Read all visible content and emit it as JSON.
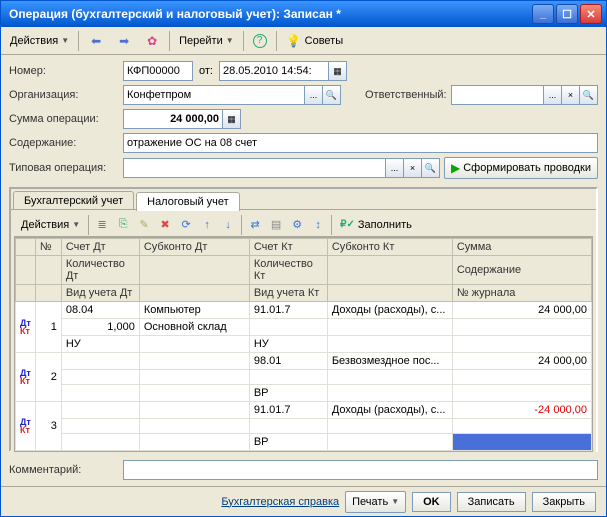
{
  "window": {
    "title": "Операция (бухгалтерский и налоговый учет): Записан *"
  },
  "main_toolbar": {
    "actions": "Действия",
    "go_to": "Перейти",
    "tips": "Советы"
  },
  "form": {
    "number_label": "Номер:",
    "number_value": "КФП00000",
    "from_label": "от:",
    "date_value": "28.05.2010 14:54:",
    "org_label": "Организация:",
    "org_value": "Конфетпром",
    "resp_label": "Ответственный:",
    "resp_value": "",
    "sum_label": "Сумма операции:",
    "sum_value": "24 000,00",
    "content_label": "Содержание:",
    "content_value": "отражение ОС на 08 счет",
    "typeop_label": "Типовая операция:",
    "typeop_value": "",
    "gen_entries": "Сформировать проводки",
    "comment_label": "Комментарий:",
    "comment_value": ""
  },
  "tabs": {
    "t1": "Бухгалтерский учет",
    "t2": "Налоговый учет"
  },
  "grid_toolbar": {
    "actions": "Действия",
    "fill": "Заполнить"
  },
  "grid": {
    "headers": {
      "num": "№",
      "acc_dt": "Счет Дт",
      "sub_dt": "Субконто Дт",
      "acc_kt": "Счет Кт",
      "sub_kt": "Субконто Кт",
      "sum": "Сумма",
      "qty_dt": "Количество Дт",
      "qty_kt": "Количество Кт",
      "content": "Содержание",
      "vid_dt": "Вид учета Дт",
      "vid_kt": "Вид учета Кт",
      "jrn": "№ журнала"
    },
    "rows": [
      {
        "n": "1",
        "acc_dt": "08.04",
        "sub_dt": "Компьютер",
        "acc_kt": "91.01.7",
        "sub_kt": "Доходы (расходы), с...",
        "sum": "24 000,00",
        "neg": false,
        "qty_dt": "1,000",
        "sub_dt2": "Основной склад",
        "vid_dt": "НУ",
        "vid_kt": "НУ"
      },
      {
        "n": "2",
        "acc_dt": "",
        "sub_dt": "",
        "acc_kt": "98.01",
        "sub_kt": "Безвозмездное пос...",
        "sum": "24 000,00",
        "neg": false,
        "qty_dt": "",
        "sub_dt2": "",
        "vid_dt": "",
        "vid_kt": "ВР"
      },
      {
        "n": "3",
        "acc_dt": "",
        "sub_dt": "",
        "acc_kt": "91.01.7",
        "sub_kt": "Доходы (расходы), с...",
        "sum": "-24 000,00",
        "neg": true,
        "qty_dt": "",
        "sub_dt2": "",
        "vid_dt": "",
        "vid_kt": "ВР"
      }
    ]
  },
  "footer": {
    "report": "Бухгалтерская справка",
    "print": "Печать",
    "ok": "OK",
    "save": "Записать",
    "close": "Закрыть"
  }
}
